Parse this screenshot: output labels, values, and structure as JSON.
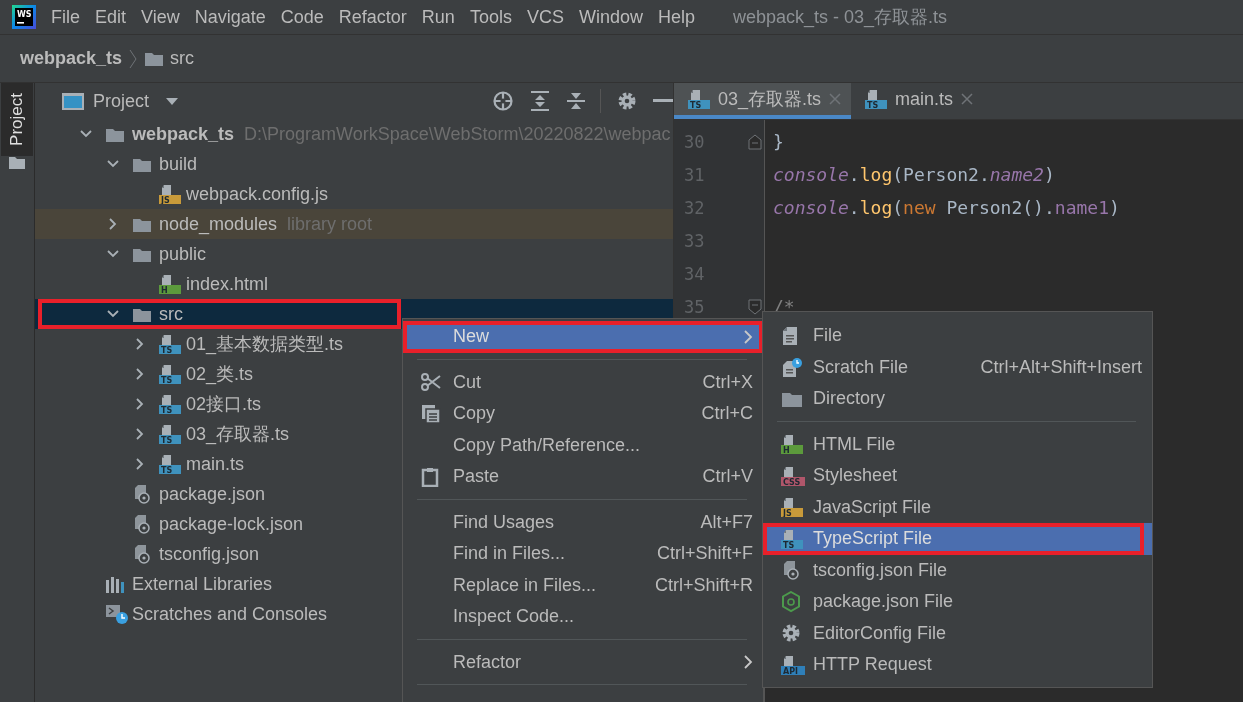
{
  "window": {
    "logo": "WS",
    "title": "webpack_ts - 03_存取器.ts"
  },
  "menu_bar": [
    {
      "label": "File"
    },
    {
      "label": "Edit"
    },
    {
      "label": "View"
    },
    {
      "label": "Navigate"
    },
    {
      "label": "Code"
    },
    {
      "label": "Refactor"
    },
    {
      "label": "Run"
    },
    {
      "label": "Tools"
    },
    {
      "label": "VCS"
    },
    {
      "label": "Window"
    },
    {
      "label": "Help"
    }
  ],
  "breadcrumb": [
    {
      "label": "webpack_ts",
      "kind": "project"
    },
    {
      "label": "src",
      "kind": "folder"
    }
  ],
  "tool_strip": [
    {
      "label": "Project",
      "selected": true
    }
  ],
  "project_panel": {
    "title": "Project",
    "tree": [
      {
        "label": "webpack_ts",
        "path": "D:\\ProgramWorkSpace\\WebStorm\\20220822\\webpac",
        "kind": "folder",
        "expanded": true,
        "selected": false,
        "highlighted": false,
        "children": [
          {
            "label": "build",
            "kind": "folder",
            "expanded": true,
            "selected": false,
            "highlighted": false,
            "children": [
              {
                "label": "webpack.config.js",
                "kind": "file",
                "badge": "JS",
                "color": "#c89a3a",
                "selected": false,
                "highlighted": false
              }
            ]
          },
          {
            "label": "node_modules",
            "note": "library root",
            "kind": "library-folder",
            "expanded": false,
            "selected": false,
            "highlighted": false
          },
          {
            "label": "public",
            "kind": "folder",
            "expanded": true,
            "selected": false,
            "highlighted": false,
            "children": [
              {
                "label": "index.html",
                "kind": "file",
                "badge": "H",
                "color": "#5c9a3c",
                "selected": false,
                "highlighted": false
              }
            ]
          },
          {
            "label": "src",
            "kind": "folder",
            "expanded": true,
            "selected": true,
            "highlighted": true,
            "children": [
              {
                "label": "01_基本数据类型.ts",
                "kind": "file",
                "badge": "TS",
                "color": "#3f92bd",
                "expanded": false,
                "selected": false,
                "highlighted": false
              },
              {
                "label": "02_类.ts",
                "kind": "file",
                "badge": "TS",
                "color": "#3f92bd",
                "expanded": false,
                "selected": false,
                "highlighted": false
              },
              {
                "label": "02接口.ts",
                "kind": "file",
                "badge": "TS",
                "color": "#3f92bd",
                "expanded": false,
                "selected": false,
                "highlighted": false
              },
              {
                "label": "03_存取器.ts",
                "kind": "file",
                "badge": "TS",
                "color": "#3f92bd",
                "expanded": false,
                "selected": false,
                "highlighted": false
              },
              {
                "label": "main.ts",
                "kind": "file",
                "badge": "TS",
                "color": "#3f92bd",
                "expanded": false,
                "selected": false,
                "highlighted": false
              }
            ]
          },
          {
            "label": "package.json",
            "kind": "json",
            "selected": false,
            "highlighted": false
          },
          {
            "label": "package-lock.json",
            "kind": "json",
            "selected": false,
            "highlighted": false
          },
          {
            "label": "tsconfig.json",
            "kind": "json",
            "selected": false,
            "highlighted": false
          }
        ]
      },
      {
        "label": "External Libraries",
        "kind": "libraries",
        "selected": false,
        "highlighted": false
      },
      {
        "label": "Scratches and Consoles",
        "kind": "scratches",
        "selected": false,
        "highlighted": false
      }
    ]
  },
  "editor": {
    "tabs": [
      {
        "label": "03_存取器.ts",
        "badge": "TS",
        "color": "#3f92bd",
        "selected": true
      },
      {
        "label": "main.ts",
        "badge": "TS",
        "color": "#3f92bd",
        "selected": false
      }
    ],
    "lines": [
      {
        "number": "30",
        "kind": "fold-end",
        "tokens": [
          {
            "text": "}",
            "kind": "plain"
          }
        ]
      },
      {
        "number": "31",
        "kind": "plain",
        "tokens": [
          {
            "text": "console",
            "kind": "global"
          },
          {
            "text": ".",
            "kind": "plain"
          },
          {
            "text": "log",
            "kind": "method"
          },
          {
            "text": "(Person2.",
            "kind": "plain"
          },
          {
            "text": "name2",
            "kind": "static"
          },
          {
            "text": ")",
            "kind": "plain"
          }
        ]
      },
      {
        "number": "32",
        "kind": "plain",
        "tokens": [
          {
            "text": "console",
            "kind": "global"
          },
          {
            "text": ".",
            "kind": "plain"
          },
          {
            "text": "log",
            "kind": "method"
          },
          {
            "text": "(",
            "kind": "plain"
          },
          {
            "text": "new",
            "kind": "keyword"
          },
          {
            "text": " Person2().",
            "kind": "plain"
          },
          {
            "text": "name1",
            "kind": "field"
          },
          {
            "text": ")",
            "kind": "plain"
          }
        ]
      },
      {
        "number": "33",
        "kind": "plain"
      },
      {
        "number": "34",
        "kind": "plain"
      },
      {
        "number": "35",
        "kind": "fold-start",
        "tokens": [
          {
            "text": "/*",
            "kind": "comment"
          }
        ]
      }
    ]
  },
  "context_menu": [
    {
      "kind": "submenu",
      "label": "New",
      "selected": true,
      "highlighted": true
    },
    {
      "kind": "separator"
    },
    {
      "kind": "cut",
      "label": "Cut",
      "shortcut": "Ctrl+X",
      "selected": false,
      "highlighted": false
    },
    {
      "kind": "copy",
      "label": "Copy",
      "shortcut": "Ctrl+C",
      "selected": false,
      "highlighted": false
    },
    {
      "kind": "item",
      "label": "Copy Path/Reference...",
      "selected": false,
      "highlighted": false
    },
    {
      "kind": "paste",
      "label": "Paste",
      "shortcut": "Ctrl+V",
      "selected": false,
      "highlighted": false
    },
    {
      "kind": "separator"
    },
    {
      "kind": "item",
      "label": "Find Usages",
      "shortcut": "Alt+F7",
      "selected": false,
      "highlighted": false
    },
    {
      "kind": "item",
      "label": "Find in Files...",
      "shortcut": "Ctrl+Shift+F",
      "selected": false,
      "highlighted": false
    },
    {
      "kind": "item",
      "label": "Replace in Files...",
      "shortcut": "Ctrl+Shift+R",
      "selected": false,
      "highlighted": false
    },
    {
      "kind": "item",
      "label": "Inspect Code...",
      "selected": false,
      "highlighted": false
    },
    {
      "kind": "separator"
    },
    {
      "kind": "submenu",
      "label": "Refactor",
      "selected": false,
      "highlighted": false
    },
    {
      "kind": "separator"
    }
  ],
  "submenu": [
    {
      "kind": "file",
      "label": "File",
      "selected": false,
      "highlighted": false
    },
    {
      "kind": "scratch",
      "label": "Scratch File",
      "shortcut": "Ctrl+Alt+Shift+Insert",
      "selected": false,
      "highlighted": false
    },
    {
      "kind": "folder",
      "label": "Directory",
      "selected": false,
      "highlighted": false
    },
    {
      "kind": "separator"
    },
    {
      "kind": "badge-file",
      "label": "HTML File",
      "badge": "H",
      "color": "#5c9a3c",
      "selected": false,
      "highlighted": false
    },
    {
      "kind": "badge-file",
      "label": "Stylesheet",
      "badge": "CSS",
      "color": "#b0566a",
      "selected": false,
      "highlighted": false
    },
    {
      "kind": "badge-file",
      "label": "JavaScript File",
      "badge": "JS",
      "color": "#c89a3a",
      "selected": false,
      "highlighted": false
    },
    {
      "kind": "badge-file",
      "label": "TypeScript File",
      "badge": "TS",
      "color": "#3f92bd",
      "selected": true,
      "highlighted": true
    },
    {
      "kind": "json",
      "label": "tsconfig.json File",
      "selected": false,
      "highlighted": false
    },
    {
      "kind": "node",
      "label": "package.json File",
      "selected": false,
      "highlighted": false
    },
    {
      "kind": "gear",
      "label": "EditorConfig File",
      "selected": false,
      "highlighted": false
    },
    {
      "kind": "badge-file",
      "label": "HTTP Request",
      "badge": "API",
      "color": "#2f7fb8",
      "selected": false,
      "highlighted": false
    }
  ]
}
